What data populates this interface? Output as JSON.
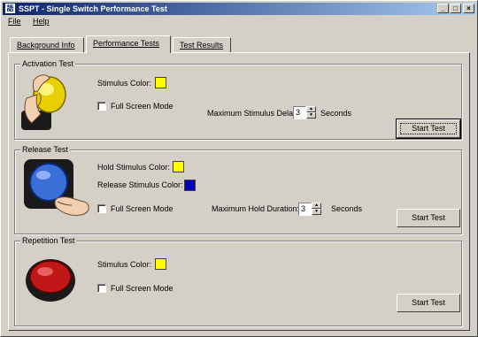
{
  "window": {
    "title": "SSPT - Single Switch Performance Test",
    "icon_text": "語",
    "controls": {
      "minimize": "_",
      "maximize": "□",
      "close": "×"
    }
  },
  "menu": {
    "file": "File",
    "help": "Help"
  },
  "tabs": [
    {
      "label": "Background Info"
    },
    {
      "label": "Performance Tests"
    },
    {
      "label": "Test Results"
    }
  ],
  "activation": {
    "title": "Activation Test",
    "stimulus_color_label": "Stimulus Color:",
    "stimulus_color": "#ffff00",
    "full_screen_label": "Full Screen Mode",
    "delay_label": "Maximum Stimulus Delay:",
    "delay_value": "3",
    "delay_unit": "Seconds",
    "start_button": "Start Test"
  },
  "release": {
    "title": "Release Test",
    "hold_color_label": "Hold Stimulus Color:",
    "hold_color": "#ffff00",
    "release_color_label": "Release Stimulus Color:",
    "release_color": "#0000c0",
    "full_screen_label": "Full Screen Mode",
    "hold_label": "Maximum Hold Duration:",
    "hold_value": "3",
    "hold_unit": "Seconds",
    "start_button": "Start Test"
  },
  "repetition": {
    "title": "Repetition Test",
    "stimulus_color_label": "Stimulus Color:",
    "stimulus_color": "#ffff00",
    "full_screen_label": "Full Screen Mode",
    "start_button": "Start Test"
  }
}
